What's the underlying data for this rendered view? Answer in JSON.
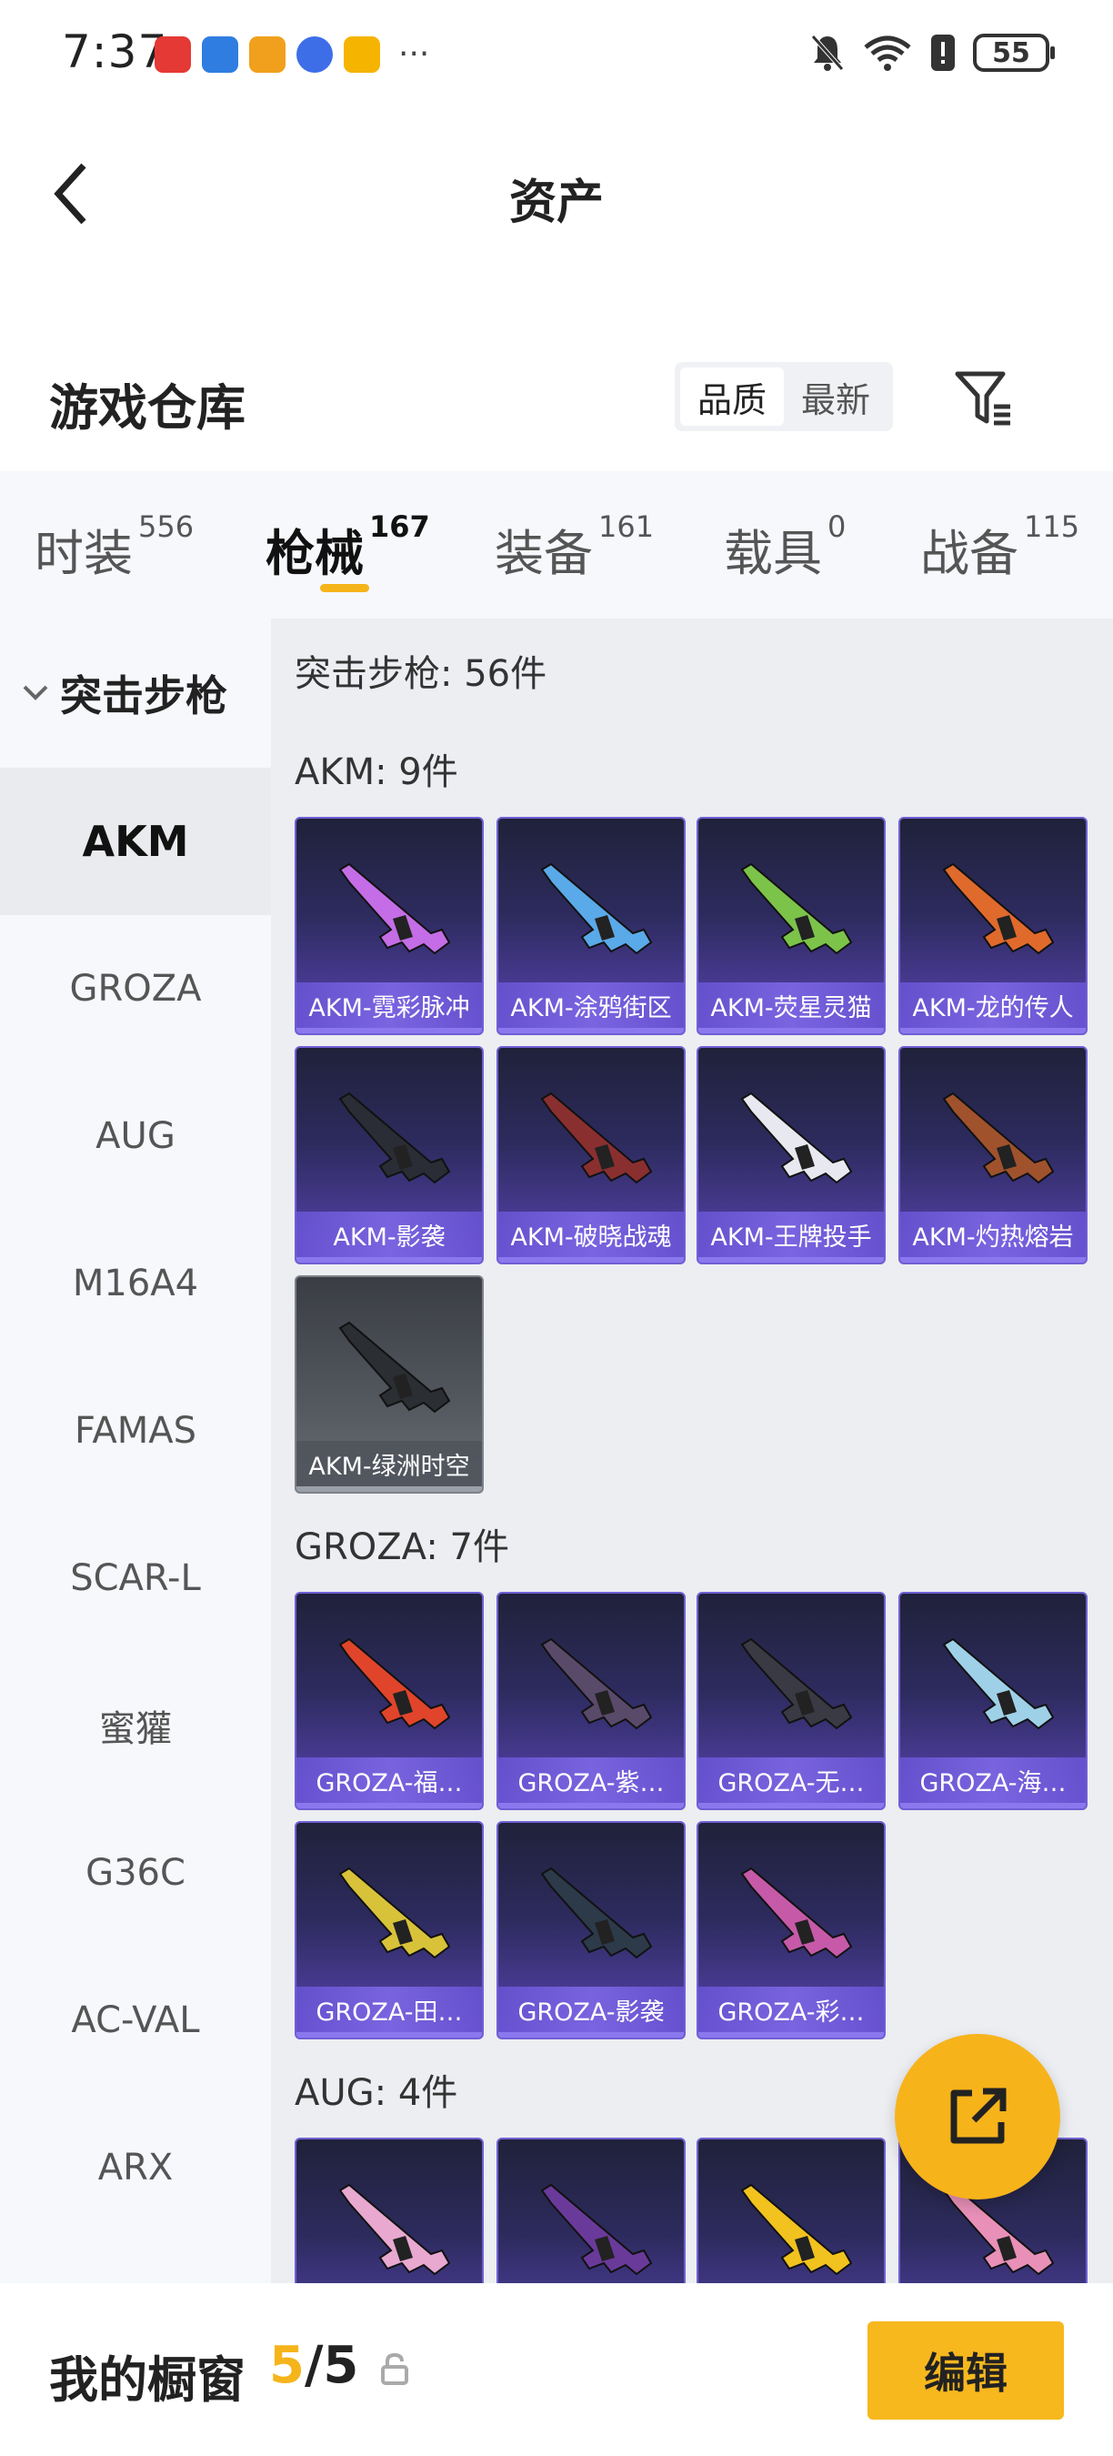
{
  "status_bar": {
    "time": "7:37",
    "battery": "55",
    "app_icons": [
      "huawei-app-icon",
      "news-app-icon",
      "game-app-icon",
      "music-app-icon",
      "cup-app-icon"
    ],
    "more": "···"
  },
  "header": {
    "title": "资产"
  },
  "warehouse": {
    "title": "游戏仓库",
    "sort_options": [
      "品质",
      "最新"
    ],
    "active_sort": "品质"
  },
  "tabs": [
    {
      "label": "时装",
      "count": "556"
    },
    {
      "label": "枪械",
      "count": "167"
    },
    {
      "label": "装备",
      "count": "161"
    },
    {
      "label": "载具",
      "count": "0"
    },
    {
      "label": "战备",
      "count": "115"
    }
  ],
  "active_tab": "枪械",
  "sidebar": {
    "category": "突击步枪",
    "items": [
      "AKM",
      "GROZA",
      "AUG",
      "M16A4",
      "FAMAS",
      "SCAR-L",
      "蜜獾",
      "G36C",
      "AC-VAL",
      "ARX"
    ],
    "active": "AKM"
  },
  "content": {
    "total": "突击步枪: 56件",
    "groups": [
      {
        "label": "AKM: 9件",
        "items": [
          "AKM-霓彩脉冲",
          "AKM-涂鸦街区",
          "AKM-荧星灵猫",
          "AKM-龙的传人",
          "AKM-影袭",
          "AKM-破晓战魂",
          "AKM-王牌投手",
          "AKM-灼热熔岩",
          "AKM-绿洲时空"
        ]
      },
      {
        "label": "GROZA: 7件",
        "items": [
          "GROZA-福…",
          "GROZA-紫…",
          "GROZA-无…",
          "GROZA-海…",
          "GROZA-田…",
          "GROZA-影袭",
          "GROZA-彩…"
        ]
      },
      {
        "label": "AUG: 4件",
        "items": [
          "",
          "",
          "",
          ""
        ]
      }
    ]
  },
  "bottom": {
    "showcase_label": "我的橱窗",
    "showcase_current": "5",
    "showcase_sep": "/",
    "showcase_total": "5",
    "edit_label": "编辑"
  },
  "colors": {
    "accent": "#f6b41b",
    "card_purple": "#5a44b4",
    "sidebar_bg": "#f6f8fc",
    "content_bg": "#eceef2"
  }
}
